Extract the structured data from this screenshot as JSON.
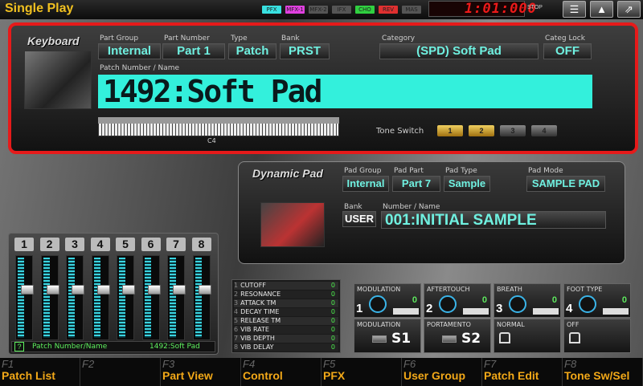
{
  "app": {
    "title": "Single Play",
    "time": "1:01:000",
    "stop": "STOP"
  },
  "fx": [
    {
      "label": "PFX",
      "color": "#38e0e0"
    },
    {
      "label": "MFX-1",
      "color": "#e040e0"
    },
    {
      "label": "MFX-2",
      "color": "#555555"
    },
    {
      "label": "IFX",
      "color": "#555555"
    },
    {
      "label": "CHO",
      "color": "#30d040"
    },
    {
      "label": "REV",
      "color": "#e03030"
    },
    {
      "label": "MAS",
      "color": "#555555"
    }
  ],
  "top_buttons": [
    {
      "icon": "menu-icon",
      "glyph": "☰"
    },
    {
      "icon": "up-arrow-icon",
      "glyph": "▲"
    },
    {
      "icon": "export-icon",
      "glyph": "⇗"
    }
  ],
  "keyboard": {
    "section": "Keyboard",
    "part_group_label": "Part Group",
    "part_group": "Internal",
    "part_number_label": "Part Number",
    "part_number": "Part 1",
    "type_label": "Type",
    "type": "Patch",
    "bank_label": "Bank",
    "bank": "PRST",
    "category_label": "Category",
    "category": "(SPD) Soft Pad",
    "categ_lock_label": "Categ Lock",
    "categ_lock": "OFF",
    "patch_label": "Patch Number / Name",
    "patch": "1492:Soft Pad",
    "key_marker": "C4",
    "tone_switch_label": "Tone Switch",
    "tones": [
      {
        "n": "1",
        "on": true
      },
      {
        "n": "2",
        "on": true
      },
      {
        "n": "3",
        "on": false
      },
      {
        "n": "4",
        "on": false
      }
    ]
  },
  "pad": {
    "section": "Dynamic Pad",
    "pad_group_label": "Pad Group",
    "pad_group": "Internal",
    "pad_part_label": "Pad Part",
    "pad_part": "Part 7",
    "pad_type_label": "Pad Type",
    "pad_type": "Sample",
    "pad_mode_label": "Pad Mode",
    "pad_mode": "SAMPLE PAD",
    "bank_label": "Bank",
    "bank": "USER",
    "number_label": "Number / Name",
    "number": "001:INITIAL SAMPLE"
  },
  "mixer": {
    "channels": [
      "1",
      "2",
      "3",
      "4",
      "5",
      "6",
      "7",
      "8"
    ],
    "status_label": "Patch Number/Name",
    "status_value": "1492:Soft Pad",
    "help": "?"
  },
  "controls": [
    {
      "n": "1",
      "name": "CUTOFF",
      "value": "0"
    },
    {
      "n": "2",
      "name": "RESONANCE",
      "value": "0"
    },
    {
      "n": "3",
      "name": "ATTACK TM",
      "value": "0"
    },
    {
      "n": "4",
      "name": "DECAY TIME",
      "value": "0"
    },
    {
      "n": "5",
      "name": "RELEASE TM",
      "value": "0"
    },
    {
      "n": "6",
      "name": "VIB RATE",
      "value": "0"
    },
    {
      "n": "7",
      "name": "VIB DEPTH",
      "value": "0"
    },
    {
      "n": "8",
      "name": "VIB DELAY",
      "value": "0"
    }
  ],
  "assign": [
    {
      "label": "MODULATION",
      "n": "1",
      "value": "0"
    },
    {
      "label": "AFTERTOUCH",
      "n": "2",
      "value": "0"
    },
    {
      "label": "BREATH",
      "n": "3",
      "value": "0"
    },
    {
      "label": "FOOT TYPE",
      "n": "4",
      "value": "0"
    }
  ],
  "switches": [
    {
      "label": "MODULATION",
      "value": "S1"
    },
    {
      "label": "PORTAMENTO",
      "value": "S2"
    },
    {
      "label": "NORMAL",
      "icon": "pedal-icon"
    },
    {
      "label": "OFF",
      "icon": "hold-icon"
    }
  ],
  "fkeys": [
    {
      "fn": "F1",
      "label": "Patch List"
    },
    {
      "fn": "F2",
      "label": ""
    },
    {
      "fn": "F3",
      "label": "Part View"
    },
    {
      "fn": "F4",
      "label": "Control"
    },
    {
      "fn": "F5",
      "label": "PFX"
    },
    {
      "fn": "F6",
      "label": "User Group"
    },
    {
      "fn": "F7",
      "label": "Patch Edit"
    },
    {
      "fn": "F8",
      "label": "Tone Sw/Sel"
    }
  ]
}
